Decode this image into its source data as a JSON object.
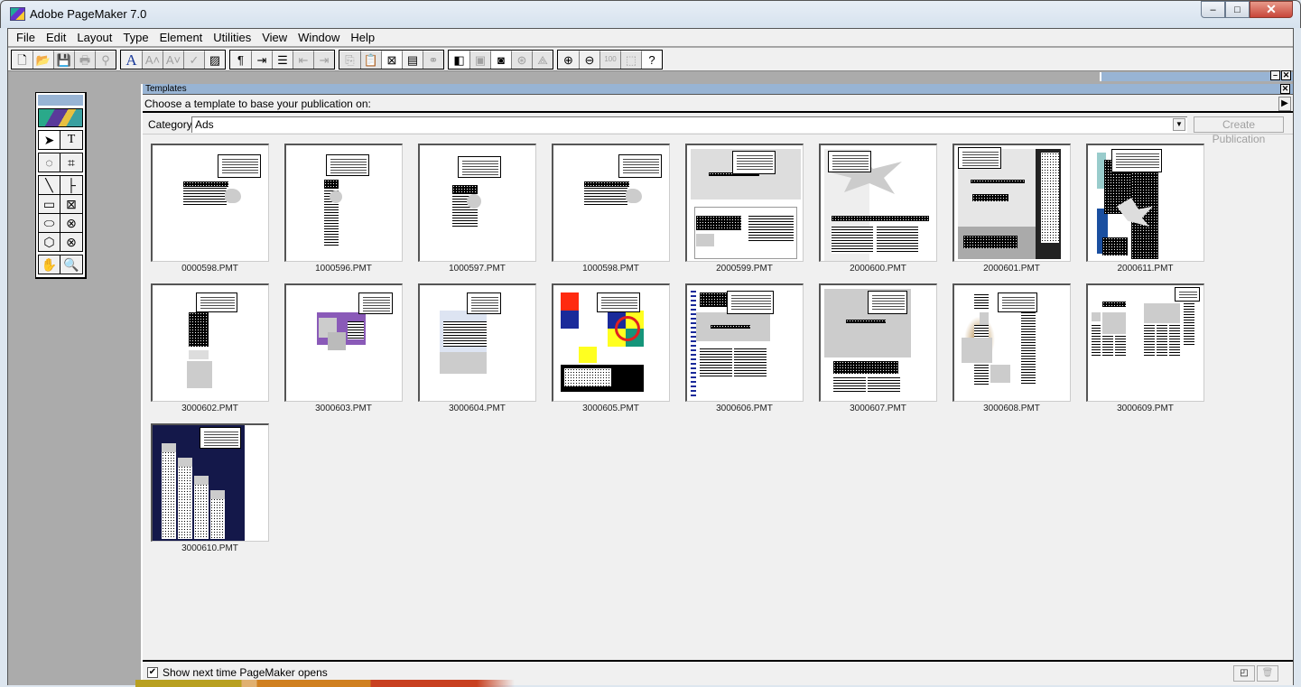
{
  "window": {
    "title": "Adobe PageMaker 7.0",
    "controls": {
      "minimize": "–",
      "maximize": "□",
      "close": "✕"
    }
  },
  "menu": [
    "File",
    "Edit",
    "Layout",
    "Type",
    "Element",
    "Utilities",
    "View",
    "Window",
    "Help"
  ],
  "toolbar": {
    "groups": [
      [
        {
          "name": "new-icon",
          "glyph": "🗋"
        },
        {
          "name": "open-icon",
          "glyph": "📂"
        },
        {
          "name": "save-icon",
          "glyph": "💾",
          "disabled": true
        },
        {
          "name": "print-icon",
          "glyph": "🖶",
          "disabled": true
        },
        {
          "name": "find-icon",
          "glyph": "⚲",
          "disabled": true
        }
      ],
      [
        {
          "name": "character-icon",
          "glyph": "A"
        },
        {
          "name": "superscript-icon",
          "glyph": "A˄",
          "disabled": true
        },
        {
          "name": "subscript-icon",
          "glyph": "A˅",
          "disabled": true
        },
        {
          "name": "spelling-icon",
          "glyph": "✓",
          "disabled": true
        },
        {
          "name": "fill-stroke-icon",
          "glyph": "▨"
        }
      ],
      [
        {
          "name": "paragraph-icon",
          "glyph": "¶"
        },
        {
          "name": "indents-icon",
          "glyph": "⇥"
        },
        {
          "name": "bullets-icon",
          "glyph": "☰"
        },
        {
          "name": "decrease-indent-icon",
          "glyph": "⇤",
          "disabled": true
        },
        {
          "name": "increase-indent-icon",
          "glyph": "⇥",
          "disabled": true
        }
      ],
      [
        {
          "name": "copy-icon",
          "glyph": "⎘",
          "disabled": true
        },
        {
          "name": "paste-icon",
          "glyph": "📋",
          "disabled": true
        },
        {
          "name": "place-icon",
          "glyph": "⊠",
          "white": true
        },
        {
          "name": "text-frame-icon",
          "glyph": "▤"
        },
        {
          "name": "link-icon",
          "glyph": "⚭",
          "disabled": true
        }
      ],
      [
        {
          "name": "color-palette-icon",
          "glyph": "◧",
          "white": true
        },
        {
          "name": "image-control-icon",
          "glyph": "▣",
          "disabled": true
        },
        {
          "name": "photo-icon",
          "glyph": "◙",
          "white": true
        },
        {
          "name": "web-icon",
          "glyph": "⊛",
          "disabled": true
        },
        {
          "name": "pdf-icon",
          "glyph": "⟁",
          "disabled": true
        }
      ],
      [
        {
          "name": "zoom-in-icon",
          "glyph": "⊕"
        },
        {
          "name": "zoom-out-icon",
          "glyph": "⊖"
        },
        {
          "name": "actual-size-icon",
          "glyph": "100",
          "disabled": true
        },
        {
          "name": "fit-page-icon",
          "glyph": "⬚",
          "disabled": true
        },
        {
          "name": "help-icon",
          "glyph": "?",
          "white": true
        }
      ]
    ]
  },
  "toolbox": {
    "rows": [
      [
        {
          "name": "pointer-tool-icon",
          "glyph": "➤",
          "selected": true
        },
        {
          "name": "text-tool-icon",
          "glyph": "T"
        }
      ],
      [
        {
          "name": "rotate-tool-icon",
          "glyph": "◌"
        },
        {
          "name": "crop-tool-icon",
          "glyph": "⌗"
        }
      ],
      [
        {
          "name": "line-tool-icon",
          "glyph": "╲"
        },
        {
          "name": "constrained-line-tool-icon",
          "glyph": "├"
        }
      ],
      [
        {
          "name": "rectangle-tool-icon",
          "glyph": "▭"
        },
        {
          "name": "rectangle-frame-tool-icon",
          "glyph": "⊠"
        }
      ],
      [
        {
          "name": "ellipse-tool-icon",
          "glyph": "⬭"
        },
        {
          "name": "ellipse-frame-tool-icon",
          "glyph": "⊗"
        }
      ],
      [
        {
          "name": "polygon-tool-icon",
          "glyph": "⬡"
        },
        {
          "name": "polygon-frame-tool-icon",
          "glyph": "⊗"
        }
      ],
      [
        {
          "name": "hand-tool-icon",
          "glyph": "✋"
        },
        {
          "name": "zoom-tool-icon",
          "glyph": "🔍"
        }
      ]
    ]
  },
  "templates_panel": {
    "title": "Templates",
    "prompt": "Choose a template to base your publication on:",
    "category_label": "Category:",
    "category_value": "Ads",
    "create_button": "Create Publication",
    "show_next_time": {
      "label": "Show next time PageMaker opens",
      "checked": true
    },
    "items": [
      {
        "file": "0000598.PMT",
        "style": "plain-ad"
      },
      {
        "file": "1000596.PMT",
        "style": "tall-ad"
      },
      {
        "file": "1000597.PMT",
        "style": "mid-ad"
      },
      {
        "file": "1000598.PMT",
        "style": "plain-ad"
      },
      {
        "file": "2000599.PMT",
        "style": "gray-top"
      },
      {
        "file": "2000600.PMT",
        "style": "starburst"
      },
      {
        "file": "2000601.PMT",
        "style": "dark-column"
      },
      {
        "file": "2000611.PMT",
        "style": "blue-side"
      },
      {
        "file": "3000602.PMT",
        "style": "stacked"
      },
      {
        "file": "3000603.PMT",
        "style": "purple"
      },
      {
        "file": "3000604.PMT",
        "style": "light-blue"
      },
      {
        "file": "3000605.PMT",
        "style": "colorful"
      },
      {
        "file": "3000606.PMT",
        "style": "gray-band"
      },
      {
        "file": "3000607.PMT",
        "style": "gray-block"
      },
      {
        "file": "3000608.PMT",
        "style": "ornate"
      },
      {
        "file": "3000609.PMT",
        "style": "columns"
      },
      {
        "file": "3000610.PMT",
        "style": "navy"
      }
    ]
  }
}
